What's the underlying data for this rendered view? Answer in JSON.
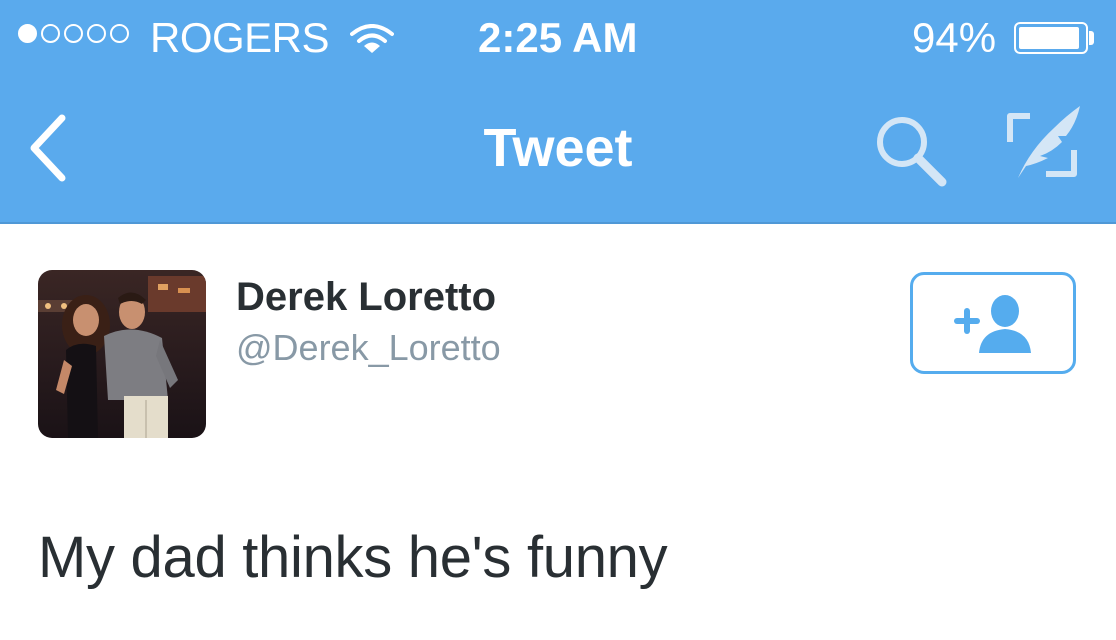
{
  "status_bar": {
    "signal_filled": 1,
    "signal_total": 5,
    "carrier": "ROGERS",
    "wifi_icon": "wifi-icon",
    "time": "2:25 AM",
    "battery_percent_label": "94%",
    "battery_level": 0.94
  },
  "nav": {
    "back_icon": "chevron-left-icon",
    "title": "Tweet",
    "search_icon": "search-icon",
    "compose_icon": "compose-tweet-icon"
  },
  "tweet": {
    "author": {
      "display_name": "Derek Loretto",
      "handle": "@Derek_Loretto",
      "avatar": "avatar-photo"
    },
    "follow_icon": "add-user-icon",
    "text": "My dad thinks he's funny"
  },
  "colors": {
    "header_blue": "#5aaaed",
    "follow_border": "#55acee",
    "text_dark": "#292f33",
    "text_gray": "#8899a6"
  }
}
